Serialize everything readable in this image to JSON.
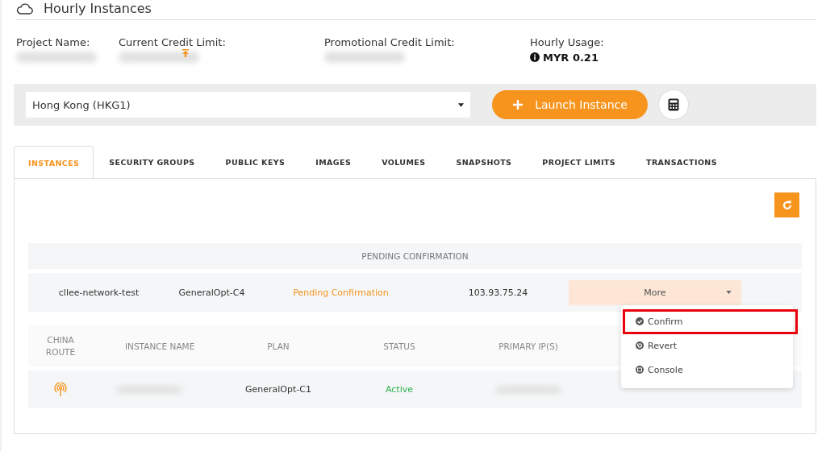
{
  "header": {
    "title": "Hourly Instances"
  },
  "summary": [
    {
      "label": "Project Name:",
      "kind": "redacted"
    },
    {
      "label": "Current Credit Limit:",
      "kind": "redacted"
    },
    {
      "label": "Promotional Credit Limit:",
      "kind": "redacted"
    },
    {
      "label": "Hourly Usage:",
      "kind": "text",
      "value": "MYR 0.21"
    }
  ],
  "region_select": {
    "value": "Hong Kong (HKG1)"
  },
  "launch_button": {
    "label": "Launch Instance"
  },
  "tabs": [
    {
      "label": "INSTANCES",
      "selected": true
    },
    {
      "label": "SECURITY GROUPS",
      "selected": false
    },
    {
      "label": "PUBLIC KEYS",
      "selected": false
    },
    {
      "label": "IMAGES",
      "selected": false
    },
    {
      "label": "VOLUMES",
      "selected": false
    },
    {
      "label": "SNAPSHOTS",
      "selected": false
    },
    {
      "label": "PROJECT LIMITS",
      "selected": false
    },
    {
      "label": "TRANSACTIONS",
      "selected": false
    }
  ],
  "pending": {
    "title": "PENDING CONFIRMATION",
    "row": {
      "name": "cllee-network-test",
      "plan": "GeneralOpt-C4",
      "status": {
        "text": "Pending Confirmation",
        "color": "#f7941d"
      },
      "ip": "103.93.75.24",
      "action": "More"
    }
  },
  "table": {
    "columns": [
      "CHINA ROUTE",
      "INSTANCE NAME",
      "PLAN",
      "STATUS",
      "PRIMARY IP(S)"
    ],
    "rows": [
      {
        "china_route": true,
        "plan": "GeneralOpt-C1",
        "status": {
          "text": "Active",
          "color": "#2bb24c"
        }
      }
    ]
  },
  "menu": [
    {
      "label": "Confirm",
      "kind": "confirm",
      "highlighted": true
    },
    {
      "label": "Revert",
      "kind": "revert",
      "highlighted": false
    },
    {
      "label": "Console",
      "kind": "console",
      "highlighted": false
    }
  ]
}
